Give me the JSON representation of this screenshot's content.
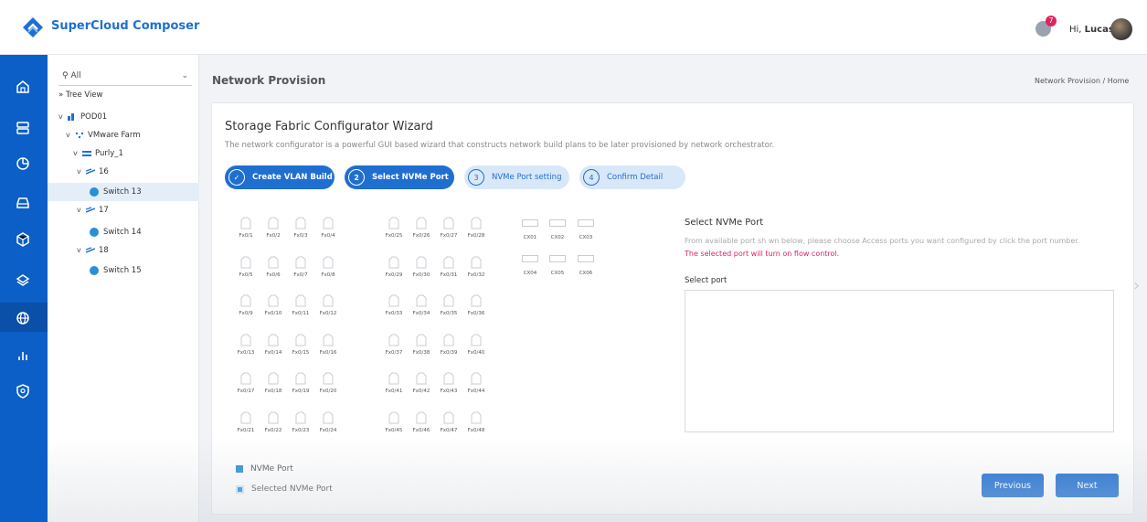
{
  "header": {
    "brand": "SuperCloud Composer",
    "notification_count": "7",
    "greeting": "Hi,",
    "user": "Lucas",
    "colors": {
      "brand": "#1f6fd1",
      "badge": "#e0245e"
    }
  },
  "sidenav": {
    "icons": [
      "home-icon",
      "server-icon",
      "pie-chart-icon",
      "storage-icon",
      "cube-icon",
      "layers-icon",
      "globe-icon",
      "bar-chart-icon",
      "shield-icon"
    ]
  },
  "tree": {
    "filter": "All",
    "view": "Tree View",
    "nodes": [
      {
        "label": "POD01",
        "toggle": "v"
      },
      {
        "label": "VMware Farm",
        "toggle": "v"
      },
      {
        "label": "Purly_1",
        "toggle": "v"
      },
      {
        "label": "16",
        "toggle": "v"
      },
      {
        "label": "Switch 13"
      },
      {
        "label": "17",
        "toggle": "v"
      },
      {
        "label": "Switch 14"
      },
      {
        "label": "18",
        "toggle": "v"
      },
      {
        "label": "Switch 15"
      }
    ]
  },
  "main": {
    "title": "Network Provision",
    "breadcrumb": "Network Provision / Home"
  },
  "wizard": {
    "title": "Storage Fabric Configurator Wizard",
    "description": "The network configurator is a powerful GUI based wizard that constructs network build plans to be later provisioned by network orchestrator.",
    "steps": [
      {
        "num": "",
        "label": "Create VLAN Build",
        "state": "done"
      },
      {
        "num": "2",
        "label": "Select NVMe Port",
        "state": "active"
      },
      {
        "num": "3",
        "label": "NVMe Port setting",
        "state": "todo"
      },
      {
        "num": "4",
        "label": "Confirm Detail",
        "state": "todo"
      }
    ]
  },
  "ports": {
    "group1": [
      "Fx0/1",
      "Fx0/2",
      "Fx0/3",
      "Fx0/4",
      "Fx0/5",
      "Fx0/6",
      "Fx0/7",
      "Fx0/8",
      "Fx0/9",
      "Fx0/10",
      "Fx0/11",
      "Fx0/12",
      "Fx0/13",
      "Fx0/14",
      "Fx0/15",
      "Fx0/16",
      "Fx0/17",
      "Fx0/18",
      "Fx0/19",
      "Fx0/20",
      "Fx0/21",
      "Fx0/22",
      "Fx0/23",
      "Fx0/24"
    ],
    "group2": [
      "Fx0/25",
      "Fx0/26",
      "Fx0/27",
      "Fx0/28",
      "Fx0/29",
      "Fx0/30",
      "Fx0/31",
      "Fx0/32",
      "Fx0/33",
      "Fx0/34",
      "Fx0/35",
      "Fx0/36",
      "Fx0/37",
      "Fx0/38",
      "Fx0/39",
      "Fx0/40",
      "Fx0/41",
      "Fx0/42",
      "Fx0/43",
      "Fx0/44",
      "Fx0/45",
      "Fx0/46",
      "Fx0/47",
      "Fx0/48"
    ],
    "cx": [
      "CX01",
      "CX02",
      "CX03",
      "CX04",
      "CX05",
      "CX06"
    ]
  },
  "selector": {
    "title": "Select NVMe Port",
    "description": "From available port sh  wn below, please choose Access ports you want configured by click the port number.",
    "warning": "The selected port will turn on flow control.",
    "select_label": "Select port"
  },
  "legend": {
    "nvme": "NVMe Port",
    "selected": "Selected NVMe Port"
  },
  "buttons": {
    "previous": "Previous",
    "next": "Next"
  }
}
